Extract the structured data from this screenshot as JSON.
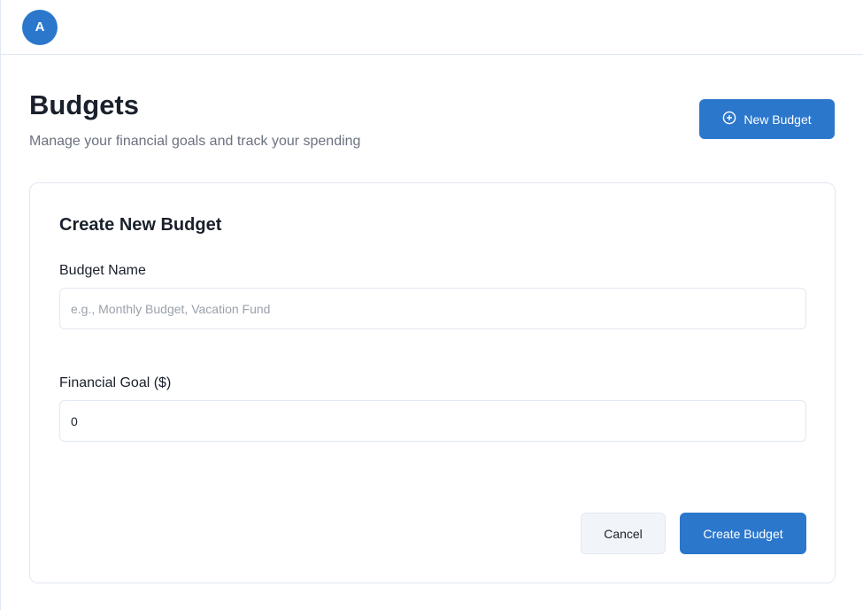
{
  "topbar": {
    "avatar_initial": "A"
  },
  "header": {
    "title": "Budgets",
    "subtitle": "Manage your financial goals and track your spending",
    "new_budget_label": "New Budget"
  },
  "form": {
    "title": "Create New Budget",
    "budget_name": {
      "label": "Budget Name",
      "placeholder": "e.g., Monthly Budget, Vacation Fund",
      "value": ""
    },
    "financial_goal": {
      "label": "Financial Goal ($)",
      "value": "0"
    },
    "cancel_label": "Cancel",
    "create_label": "Create Budget"
  },
  "colors": {
    "primary": "#2b77cc",
    "border": "#e2e8f0",
    "muted_text": "#6b7280",
    "cancel_bg": "#f1f5f9"
  }
}
